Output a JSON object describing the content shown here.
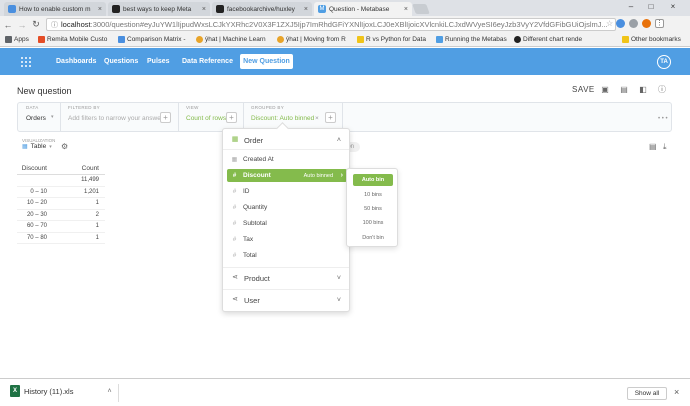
{
  "browser": {
    "tabs": [
      {
        "title": "How to enable custom m",
        "icon": "tab-favicon-blue",
        "color": "#4a8fdf"
      },
      {
        "title": "best ways to keep Meta",
        "icon": "github-icon",
        "color": "#222222"
      },
      {
        "title": "facebookarchive/huxley",
        "icon": "github-icon",
        "color": "#222222"
      },
      {
        "title": "Question - Metabase",
        "icon": "metabase-icon",
        "color": "#509ee3"
      }
    ],
    "address_prefix": "localhost",
    "address_rest": ":3000/question#eyJuYW1lIjpudWxsLCJkYXRhc2V0X3F1ZXJ5Ijp7ImRhdGFiYXNlIjoxLCJ0eXBlIjoicXVlcnkiLCJxdWVyeSI6eyJzb3VyY2VfdGFibGUiOjslmJ...",
    "bookmarks": [
      {
        "label": "Apps",
        "icon": "apps-grid-icon",
        "color": "#5f6368"
      },
      {
        "label": "Remita Mobile Custo",
        "icon": "bookmark-icon",
        "color": "#e44d26"
      },
      {
        "label": "Comparison Matrix -",
        "icon": "bookmark-icon",
        "color": "#4a8fdf"
      },
      {
        "label": "ŷhat | Machine Learn",
        "icon": "yhat-icon",
        "color": "#e8a42a"
      },
      {
        "label": "ŷhat | Moving from R",
        "icon": "yhat-icon",
        "color": "#e8a42a"
      },
      {
        "label": "R vs Python for Data",
        "icon": "bookmark-icon",
        "color": "#f0c419"
      },
      {
        "label": "Running the Metabas",
        "icon": "metabase-icon",
        "color": "#509ee3"
      },
      {
        "label": "Different chart rende",
        "icon": "github-icon",
        "color": "#222222"
      },
      {
        "label": "Other bookmarks",
        "icon": "folder-icon",
        "color": "#f0c419"
      }
    ]
  },
  "nav": {
    "links": [
      "Dashboards",
      "Questions",
      "Pulses",
      "Data Reference"
    ],
    "new_question": "New Question",
    "avatar": "TA"
  },
  "question": {
    "title": "New question",
    "save": "SAVE"
  },
  "query_builder": {
    "data_label": "DATA",
    "data_value": "Orders",
    "filter_label": "FILTERED BY",
    "filter_placeholder": "Add filters to narrow your answer",
    "view_label": "VIEW",
    "view_value": "Count of rows",
    "group_label": "GROUPED BY",
    "group_value": "Discount: Auto binned",
    "more": "• • •"
  },
  "visualization": {
    "label": "VISUALIZATION",
    "value": "Table",
    "ghost_button": "ion"
  },
  "result_table": {
    "columns": [
      "Discount",
      "Count"
    ],
    "rows": [
      [
        "",
        "11,499"
      ],
      [
        "0 – 10",
        "1,201"
      ],
      [
        "10 – 20",
        "1"
      ],
      [
        "20 – 30",
        "2"
      ],
      [
        "60 – 70",
        "1"
      ],
      [
        "70 – 80",
        "1"
      ]
    ]
  },
  "popover": {
    "sections": {
      "order": "Order",
      "product": "Product",
      "user": "User"
    },
    "fields": [
      {
        "label": "Created At",
        "icon": "calendar-icon",
        "glyph": "▦"
      },
      {
        "label": "Discount",
        "icon": "hash-icon",
        "glyph": "#",
        "binned": "Auto binned"
      },
      {
        "label": "ID",
        "icon": "hash-icon",
        "glyph": "#"
      },
      {
        "label": "Quantity",
        "icon": "hash-icon",
        "glyph": "#"
      },
      {
        "label": "Subtotal",
        "icon": "hash-icon",
        "glyph": "#"
      },
      {
        "label": "Tax",
        "icon": "hash-icon",
        "glyph": "#"
      },
      {
        "label": "Total",
        "icon": "hash-icon",
        "glyph": "#"
      }
    ],
    "bins": [
      "Auto bin",
      "10 bins",
      "50 bins",
      "100 bins",
      "Don't bin"
    ]
  },
  "downloads": {
    "file": "History (11).xls",
    "show_all": "Show all"
  },
  "colors": {
    "brand": "#509ee3",
    "selected": "#84bb4c",
    "selected_text": "#84bb4c"
  }
}
